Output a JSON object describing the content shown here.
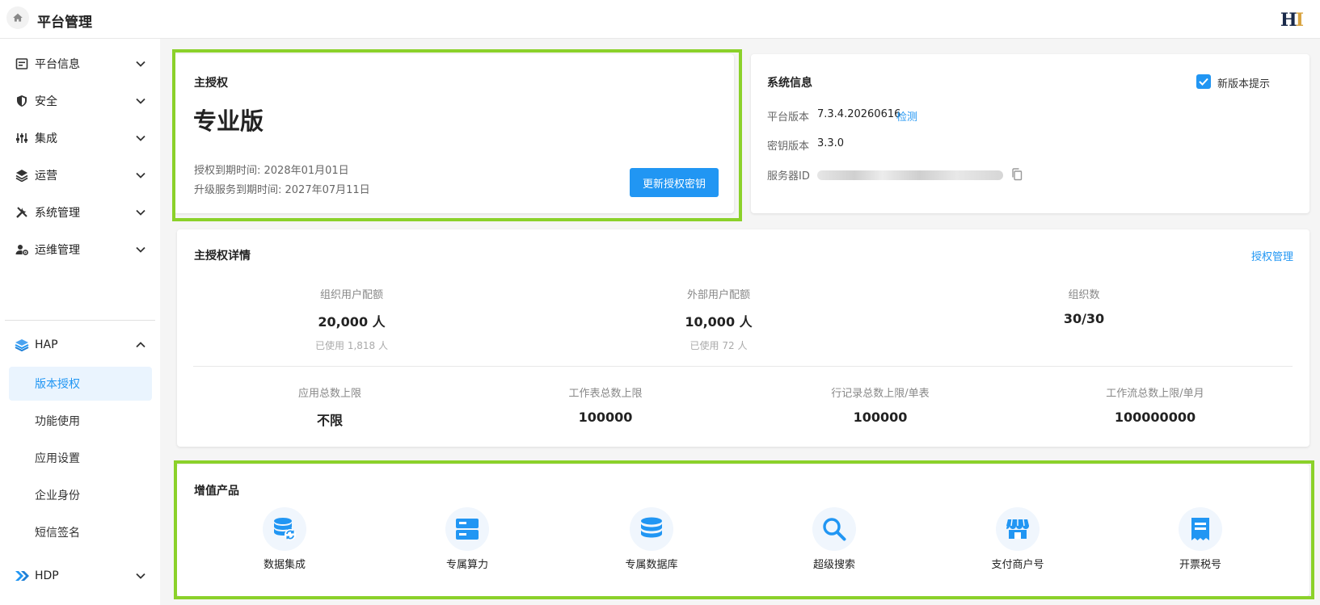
{
  "header": {
    "title": "平台管理",
    "logo_text": "H",
    "logo_accent": "I"
  },
  "sidebar": {
    "items": [
      {
        "label": "平台信息",
        "icon": "info-card-icon"
      },
      {
        "label": "安全",
        "icon": "shield-icon"
      },
      {
        "label": "集成",
        "icon": "sliders-icon"
      },
      {
        "label": "运营",
        "icon": "layers-icon"
      },
      {
        "label": "系统管理",
        "icon": "tools-icon"
      },
      {
        "label": "运维管理",
        "icon": "user-gear-icon"
      },
      {
        "label": "HAP",
        "icon": "hap-stack-icon"
      },
      {
        "label": "HDP",
        "icon": "double-chevron-icon"
      }
    ],
    "hap_subitems": [
      {
        "label": "版本授权",
        "active": true
      },
      {
        "label": "功能使用",
        "active": false
      },
      {
        "label": "应用设置",
        "active": false
      },
      {
        "label": "企业身份",
        "active": false
      },
      {
        "label": "短信签名",
        "active": false
      }
    ]
  },
  "license": {
    "title": "主授权",
    "edition": "专业版",
    "expire_label": "授权到期时间: 2028年01月01日",
    "upgrade_label": "升级服务到期时间: 2027年07月11日",
    "renew_button": "更新授权密钥"
  },
  "sysinfo": {
    "title": "系统信息",
    "new_version_hint": "新版本提示",
    "platform_version_label": "平台版本",
    "platform_version": "7.3.4.20260616",
    "check_link": "检测",
    "key_version_label": "密钥版本",
    "key_version": "3.3.0",
    "server_id_label": "服务器ID"
  },
  "details": {
    "title": "主授权详情",
    "manage_link": "授权管理",
    "row1": [
      {
        "label": "组织用户配额",
        "value": "20,000 人",
        "sub": "已使用 1,818 人"
      },
      {
        "label": "外部用户配额",
        "value": "10,000 人",
        "sub": "已使用 72 人"
      },
      {
        "label": "组织数",
        "value": "30/30",
        "sub": ""
      }
    ],
    "row2": [
      {
        "label": "应用总数上限",
        "value": "不限"
      },
      {
        "label": "工作表总数上限",
        "value": "100000"
      },
      {
        "label": "行记录总数上限/单表",
        "value": "100000"
      },
      {
        "label": "工作流总数上限/单月",
        "value": "100000000"
      }
    ]
  },
  "products": {
    "title": "增值产品",
    "items": [
      {
        "label": "数据集成",
        "icon": "database-sync-icon"
      },
      {
        "label": "专属算力",
        "icon": "server-icon"
      },
      {
        "label": "专属数据库",
        "icon": "database-icon"
      },
      {
        "label": "超级搜索",
        "icon": "search-icon"
      },
      {
        "label": "支付商户号",
        "icon": "storefront-icon"
      },
      {
        "label": "开票税号",
        "icon": "receipt-icon"
      }
    ]
  },
  "colors": {
    "accent": "#2196f3",
    "highlight": "#8bd12a"
  }
}
